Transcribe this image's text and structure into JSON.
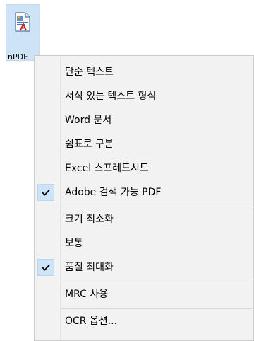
{
  "desktop_icon": {
    "label": "nPDF",
    "icon": "pdf-file-icon"
  },
  "context_menu": {
    "items": [
      {
        "label": "단순 텍스트",
        "checked": false
      },
      {
        "label": "서식 있는 텍스트 형식",
        "checked": false
      },
      {
        "label": "Word 문서",
        "checked": false
      },
      {
        "label": "쉼표로 구분",
        "checked": false
      },
      {
        "label": "Excel 스프레드시트",
        "checked": false
      },
      {
        "label": "Adobe 검색 가능 PDF",
        "checked": true
      },
      {
        "label": "크기 최소화",
        "checked": false
      },
      {
        "label": "보통",
        "checked": false
      },
      {
        "label": "품질 최대화",
        "checked": true
      },
      {
        "label": "MRC 사용",
        "checked": false
      },
      {
        "label": "OCR 옵션...",
        "checked": false
      }
    ],
    "check_icon": "checkmark-icon",
    "colors": {
      "menu_bg": "#f2f2f2",
      "check_bg": "#cde4f8",
      "icon_selection": "#cfe3f7"
    }
  }
}
